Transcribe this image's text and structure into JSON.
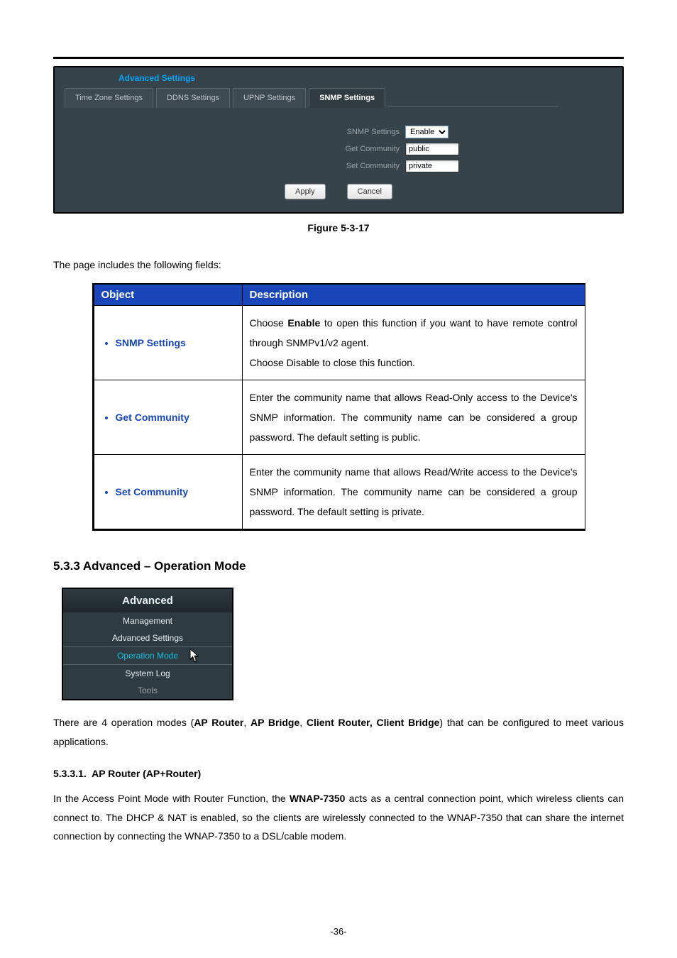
{
  "screenshot": {
    "title": "Advanced Settings",
    "tabs": [
      "Time Zone Settings",
      "DDNS Settings",
      "UPNP Settings",
      "SNMP Settings"
    ],
    "active_tab_index": 3,
    "rows": {
      "snmp_label": "SNMP Settings",
      "snmp_value": "Enable",
      "get_label": "Get Community",
      "get_value": "public",
      "set_label": "Set Community",
      "set_value": "private"
    },
    "apply": "Apply",
    "cancel": "Cancel"
  },
  "figure_caption": "Figure 5-3-17",
  "intro": "The page includes the following fields:",
  "table": {
    "headers": [
      "Object",
      "Description"
    ],
    "rows": [
      {
        "object": "SNMP Settings",
        "desc_pre": "Choose ",
        "desc_bold": "Enable",
        "desc_post": " to open this function if you want to have remote control through SNMPv1/v2 agent.",
        "desc_line2": "Choose Disable to close this function."
      },
      {
        "object": "Get Community",
        "desc": "Enter the community name that allows Read-Only access to the Device's SNMP information. The community name can be considered a group password. The default setting is public."
      },
      {
        "object": "Set Community",
        "desc": "Enter the community name that allows Read/Write access to the Device's SNMP information. The community name can be considered a group password. The default setting is private."
      }
    ]
  },
  "section_5_3_3": "5.3.3  Advanced – Operation Mode",
  "adv_menu": {
    "header": "Advanced",
    "items": [
      "Management",
      "Advanced Settings",
      "Operation Mode",
      "System Log",
      "Tools"
    ]
  },
  "modes_sentence": {
    "pre": "There are 4 operation modes (",
    "m1": "AP Router",
    "sep1": ", ",
    "m2": "AP Bridge",
    "sep2": ", ",
    "m3": "Client Router, Client Bridge",
    "post": ") that can be configured to meet various applications."
  },
  "subhead": {
    "num": "5.3.3.1.",
    "title": "AP Router (AP+Router)"
  },
  "body_para": {
    "pre": "In the Access Point Mode with Router Function, the ",
    "bold": "WNAP-7350",
    "post": " acts as a central connection point, which wireless clients can connect to. The DHCP & NAT is enabled, so the clients are wirelessly connected to the WNAP-7350 that can share the internet connection by connecting the WNAP-7350 to a DSL/cable modem."
  },
  "page_number": "-36-"
}
